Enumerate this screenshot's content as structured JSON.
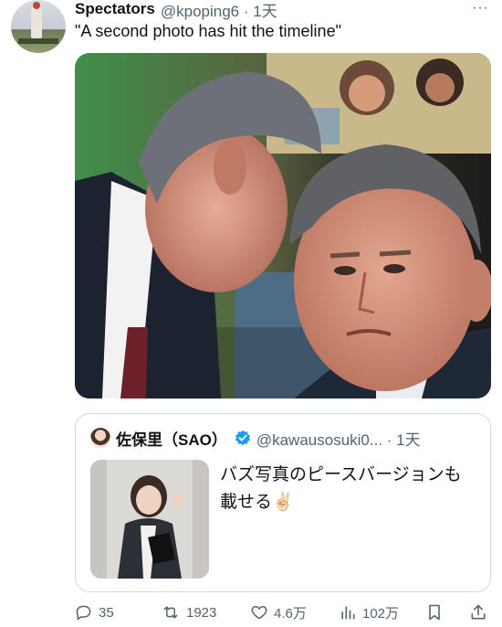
{
  "tweet": {
    "display_name": "Spectators",
    "handle_time": "@kpoping6 · 1天",
    "more_label": "···",
    "text": "\"A second photo has hit the timeline\""
  },
  "quote": {
    "display_name": "佐保里（SAO）",
    "handle_time": "@kawausosuki0... · 1天",
    "text": "バズ写真のピースバージョンも載せる✌🏻"
  },
  "actions": {
    "replies": "35",
    "retweets": "1923",
    "likes": "4.6万",
    "views": "102万"
  },
  "icons": {
    "verified": "verified-badge-icon",
    "reply": "reply-icon",
    "retweet": "retweet-icon",
    "like": "heart-icon",
    "views": "views-icon",
    "bookmark": "bookmark-icon",
    "share": "share-icon"
  },
  "colors": {
    "text": "#0f1419",
    "muted": "#536471",
    "verified": "#1d9bf0",
    "border": "#cfd9de"
  }
}
